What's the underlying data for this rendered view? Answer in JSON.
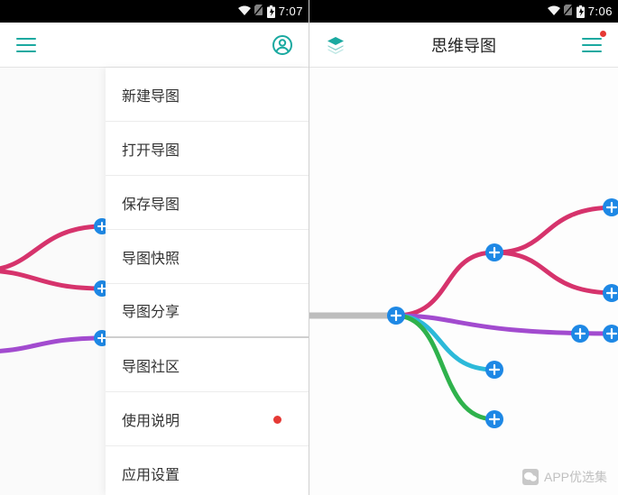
{
  "left": {
    "status_time": "7:07",
    "menu_items": [
      {
        "label": "新建导图",
        "sep": false,
        "dot": false
      },
      {
        "label": "打开导图",
        "sep": false,
        "dot": false
      },
      {
        "label": "保存导图",
        "sep": false,
        "dot": false
      },
      {
        "label": "导图快照",
        "sep": false,
        "dot": false
      },
      {
        "label": "导图分享",
        "sep": true,
        "dot": false
      },
      {
        "label": "导图社区",
        "sep": false,
        "dot": false
      },
      {
        "label": "使用说明",
        "sep": false,
        "dot": true
      },
      {
        "label": "应用设置",
        "sep": false,
        "dot": false
      }
    ]
  },
  "right": {
    "status_time": "7:06",
    "title": "思维导图"
  },
  "colors": {
    "magenta": "#d6336c",
    "purple": "#a24bcf",
    "cyan": "#2cb9d9",
    "green": "#2fb24c",
    "grey": "#bdbdbd",
    "node": "#1e88e5"
  },
  "watermark": "APP优选集"
}
